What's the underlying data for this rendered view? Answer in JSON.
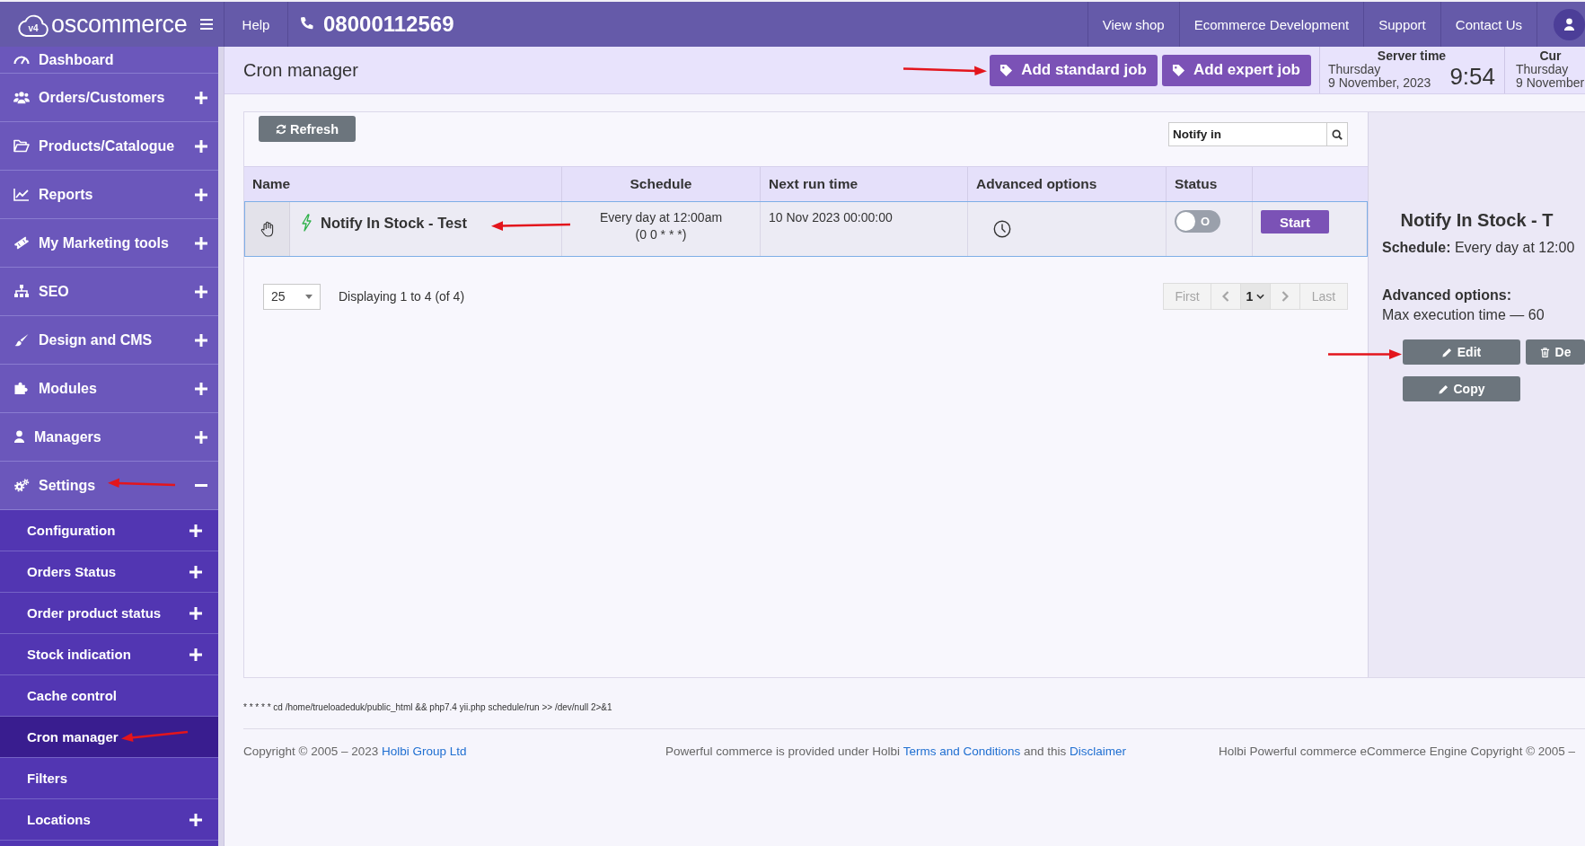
{
  "top_bar": {
    "logo": {
      "badge": "v4",
      "name": "oscommerce"
    },
    "help": "Help",
    "phone": "08000112569",
    "links": [
      "View shop",
      "Ecommerce Development",
      "Support",
      "Contact Us"
    ]
  },
  "sidebar": {
    "items": [
      {
        "label": "Dashboard",
        "kind": "page",
        "selected": false
      },
      {
        "label": "Orders/Customers",
        "kind": "group",
        "expanded": false,
        "selected": false
      },
      {
        "label": "Products/Catalogue",
        "kind": "group",
        "expanded": false,
        "selected": false
      },
      {
        "label": "Reports",
        "kind": "group",
        "expanded": false,
        "selected": false
      },
      {
        "label": "My Marketing tools",
        "kind": "group",
        "expanded": false,
        "selected": false
      },
      {
        "label": "SEO",
        "kind": "group",
        "expanded": false,
        "selected": false
      },
      {
        "label": "Design and CMS",
        "kind": "group",
        "expanded": false,
        "selected": false
      },
      {
        "label": "Modules",
        "kind": "group",
        "expanded": false,
        "selected": false
      },
      {
        "label": "Managers",
        "kind": "group",
        "expanded": false,
        "selected": false
      },
      {
        "label": "Settings",
        "kind": "group",
        "expanded": true,
        "selected": false,
        "children": [
          {
            "label": "Configuration",
            "kind": "group",
            "expanded": false,
            "selected": false
          },
          {
            "label": "Orders Status",
            "kind": "group",
            "expanded": false,
            "selected": false
          },
          {
            "label": "Order product status",
            "kind": "group",
            "expanded": false,
            "selected": false
          },
          {
            "label": "Stock indication",
            "kind": "group",
            "expanded": false,
            "selected": false
          },
          {
            "label": "Cache control",
            "kind": "page",
            "selected": false
          },
          {
            "label": "Cron manager",
            "kind": "page",
            "selected": true
          },
          {
            "label": "Filters",
            "kind": "page",
            "selected": false
          },
          {
            "label": "Locations",
            "kind": "group",
            "expanded": false,
            "selected": false
          }
        ]
      }
    ]
  },
  "page_header": {
    "title": "Cron manager",
    "actions": [
      "Add standard job",
      "Add expert job"
    ],
    "clocks": [
      {
        "title": "Server time",
        "day": "Thursday",
        "date": "9 November, 2023",
        "time": "9:54"
      },
      {
        "title": "Cur",
        "day": "Thursday",
        "date": "9 November"
      }
    ]
  },
  "toolbar": {
    "refresh": "Refresh",
    "search": {
      "value": "Notify in"
    }
  },
  "table": {
    "columns": [
      "Name",
      "Schedule",
      "Next run time",
      "Advanced options",
      "Status"
    ],
    "rows": [
      {
        "selected": true,
        "name": "Notify In Stock - Test",
        "schedule": "Every day at 12:00am",
        "cron": "(0 0 * * *)",
        "next_run": "10 Nov 2023 00:00:00",
        "status": {
          "on": false,
          "label": "O"
        },
        "action": "Start"
      }
    ]
  },
  "pagination": {
    "per_page": "25",
    "info": "Displaying 1 to 4 (of 4)",
    "first": "First",
    "page": "1",
    "last": "Last",
    "disabled": true
  },
  "detail": {
    "title": "Notify In Stock - T",
    "schedule": "**Schedule:** Every day at 12:00",
    "options_label": "Advanced options:",
    "options": "Max execution time — 60",
    "buttons": [
      {
        "kind": "edit",
        "label": "Edit"
      },
      {
        "kind": "delete",
        "label": "De"
      },
      {
        "kind": "copy",
        "label": "Copy"
      }
    ]
  },
  "command": "* * * * * cd /home/trueloadeduk/public_html && php7.4 yii.php schedule/run >> /dev/null 2>&1",
  "footer": {
    "left": "Copyright © 2005 – 2023",
    "left_link": "Holbi Group Ltd",
    "center": [
      {
        "text": "Powerful commerce is provided under Holbi"
      },
      {
        "link": "Terms and Conditions"
      },
      {
        "text": "and this"
      },
      {
        "link": "Disclaimer"
      }
    ],
    "right": "Holbi Powerful commerce eCommerce Engine Copyright © 2005 –"
  }
}
